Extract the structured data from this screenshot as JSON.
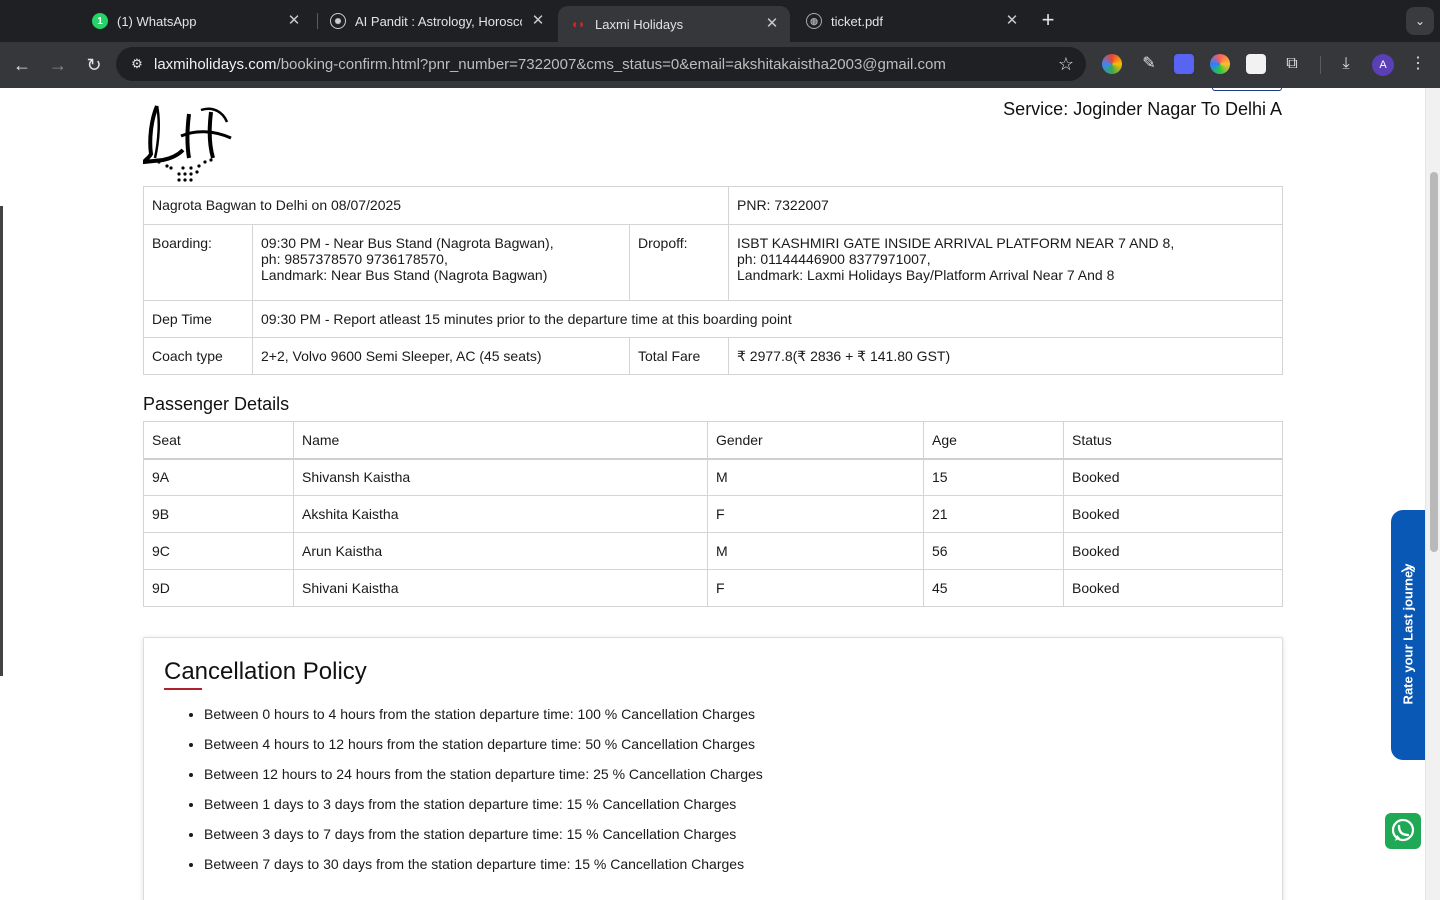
{
  "browser": {
    "tabs": [
      {
        "title": "(1) WhatsApp",
        "icon": "whatsapp-icon",
        "active": false
      },
      {
        "title": "AI Pandit : Astrology, Horoscope",
        "icon": "openai-icon",
        "active": false
      },
      {
        "title": "Laxmi Holidays",
        "icon": "laxmi-favicon",
        "active": true
      },
      {
        "title": "ticket.pdf",
        "icon": "globe-icon",
        "active": false
      }
    ],
    "new_tab": "+",
    "url_host": "laxmiholidays.com",
    "url_path": "/booking-confirm.html?pnr_number=7322007&cms_status=0&email=akshitakaistha2003@gmail.com",
    "profile_initial": "A",
    "whatsapp_badge": "1"
  },
  "page": {
    "service": "Service: Joginder Nagar To Delhi A",
    "route": "Nagrota Bagwan to Delhi on 08/07/2025",
    "pnr": "PNR: 7322007",
    "boarding_label": "Boarding:",
    "boarding_lines": [
      "09:30 PM - Near Bus Stand (Nagrota Bagwan),",
      "ph: 9857378570 9736178570,",
      "Landmark: Near Bus Stand (Nagrota Bagwan)"
    ],
    "dropoff_label": "Dropoff:",
    "dropoff_lines": [
      "ISBT KASHMIRI GATE INSIDE ARRIVAL PLATFORM NEAR 7 AND 8,",
      "ph: 01144446900 8377971007,",
      "Landmark: Laxmi Holidays Bay/Platform Arrival Near 7 And 8"
    ],
    "dep_time_label": "Dep Time",
    "dep_time": "09:30 PM - Report atleast 15 minutes prior to the departure time at this boarding point",
    "coach_label": "Coach type",
    "coach": "2+2, Volvo 9600 Semi Sleeper, AC (45 seats)",
    "fare_label": "Total Fare",
    "fare": "₹ 2977.8(₹ 2836 + ₹ 141.80 GST)",
    "passenger_title": "Passenger Details",
    "passenger_headers": [
      "Seat",
      "Name",
      "Gender",
      "Age",
      "Status"
    ],
    "passengers": [
      [
        "9A",
        "Shivansh Kaistha",
        "M",
        "15",
        "Booked"
      ],
      [
        "9B",
        "Akshita Kaistha",
        "F",
        "21",
        "Booked"
      ],
      [
        "9C",
        "Arun Kaistha",
        "M",
        "56",
        "Booked"
      ],
      [
        "9D",
        "Shivani Kaistha",
        "F",
        "45",
        "Booked"
      ]
    ],
    "cancellation_title": "Cancellation Policy",
    "cancellation_items": [
      "Between 0 hours to 4 hours from the station departure time: 100 % Cancellation Charges",
      "Between 4 hours to 12 hours from the station departure time: 50 % Cancellation Charges",
      "Between 12 hours to 24 hours from the station departure time: 25 % Cancellation Charges",
      "Between 1 days to 3 days from the station departure time: 15 % Cancellation Charges",
      "Between 3 days to 7 days from the station departure time: 15 % Cancellation Charges",
      "Between 7 days to 30 days from the station departure time: 15 % Cancellation Charges"
    ],
    "rate_tab": "Rate your Last journey",
    "colors": {
      "accent_red": "#b3202d",
      "rate_blue": "#0a58b5",
      "whatsapp_green": "#1fa855"
    }
  }
}
